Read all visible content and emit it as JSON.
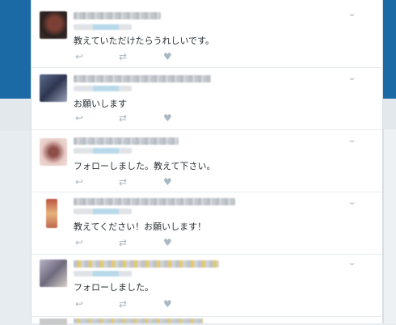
{
  "tweets": [
    {
      "text": "教えていただけたらうれしいです。",
      "avatar_color": "#5a3b33"
    },
    {
      "text": "お願いします",
      "avatar_color": "#4a5472"
    },
    {
      "text": "フォローしました。教えて下さい。",
      "avatar_color": "#d9b7b2"
    },
    {
      "text": "教えてください！お願いします！",
      "avatar_color": "#c7836a"
    },
    {
      "text": "フォローしました。",
      "avatar_color": "#8f8a99"
    }
  ],
  "icons": {
    "reply": "↩",
    "retweet": "⇄",
    "like": "♥",
    "more": "⌄"
  },
  "colors": {
    "header_blue": "#1b6aa5",
    "handle_blue": "#b7d9ea",
    "icon_gray": "#aab8c2",
    "text": "#292f33"
  }
}
